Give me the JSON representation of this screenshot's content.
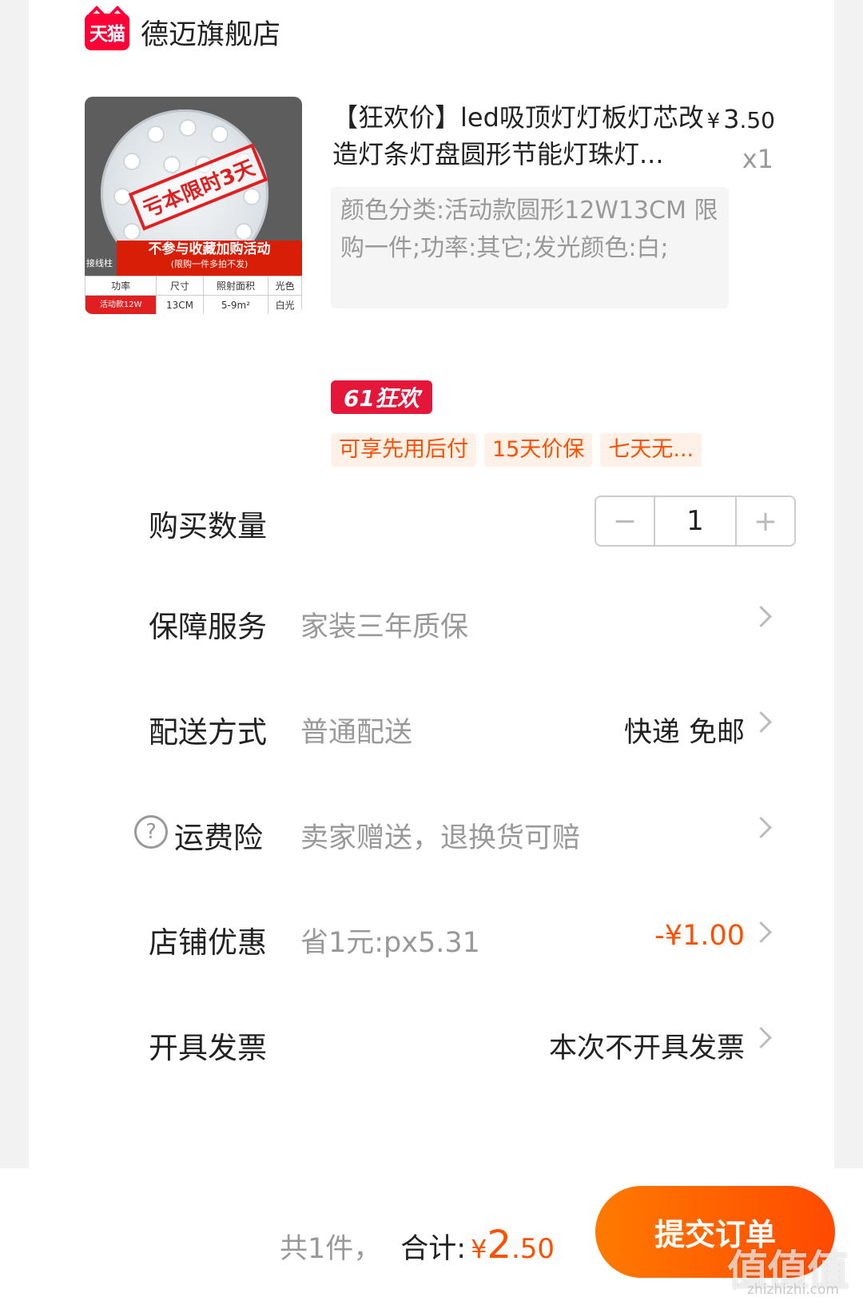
{
  "store": {
    "logo_text": "天猫",
    "name": "德迈旗舰店"
  },
  "product": {
    "image": {
      "stamp": "亏本限时3天",
      "banner": "不参与收藏加购活动",
      "banner_sub": "(限购一件多拍不发)",
      "side_label": "接线柱",
      "table_headers": [
        "功率",
        "尺寸",
        "照射面积",
        "光色"
      ],
      "table_values": [
        "活动款12W",
        "13CM",
        "5-9m²",
        "白光"
      ]
    },
    "title": "【狂欢价】led吸顶灯灯板灯芯改造灯条灯盘圆形节能灯珠灯...",
    "price_symbol": "¥",
    "price_int": "3",
    "price_dec": ".50",
    "quantity_text": "x1",
    "sku": "颜色分类:活动款圆形12W13CM 限购一件;功率:其它;发光颜色:白;"
  },
  "promo": {
    "badge": "61狂欢",
    "tags": [
      "可享先用后付",
      "15天价保",
      "七天无..."
    ]
  },
  "rows": {
    "quantity": {
      "label": "购买数量",
      "minus": "−",
      "value": "1",
      "plus": "+"
    },
    "guarantee": {
      "label": "保障服务",
      "value": "家装三年质保"
    },
    "delivery": {
      "label": "配送方式",
      "value": "普通配送",
      "right": "快递 免邮"
    },
    "insurance": {
      "icon": "?",
      "label": "运费险",
      "value": "卖家赠送，退换货可赔"
    },
    "discount": {
      "label": "店铺优惠",
      "value": "省1元:px5.31",
      "right": "-¥1.00"
    },
    "invoice": {
      "label": "开具发票",
      "right": "本次不开具发票"
    }
  },
  "bottom": {
    "count": "共1件，",
    "total_label": "合计:",
    "total_symbol": "¥",
    "total_int": "2",
    "total_dec": ".50",
    "submit": "提交订单"
  },
  "watermark": {
    "text": "值值值",
    "sub": "zhizhizhi.com"
  },
  "colors": {
    "accent": "#ff5000",
    "tmall_red": "#ff0036",
    "badge_red": "#e4173b"
  }
}
